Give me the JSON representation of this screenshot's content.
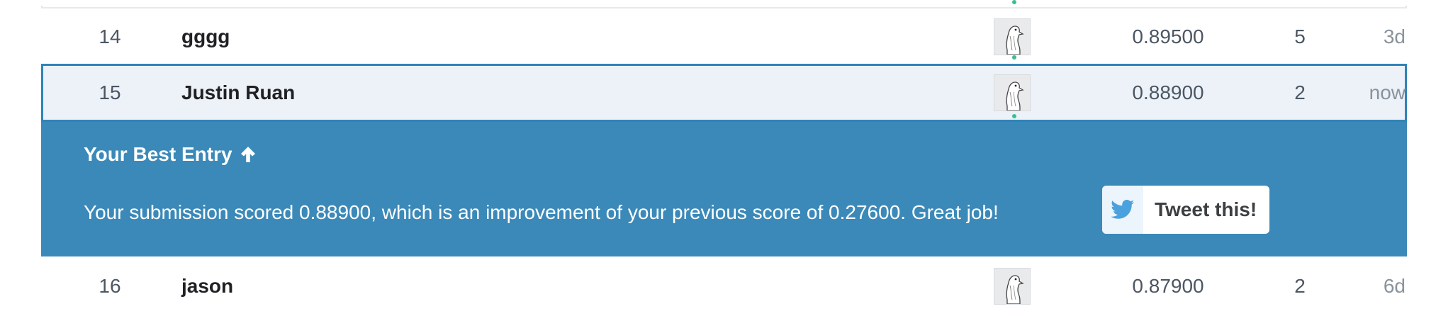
{
  "leaderboard": {
    "rows": [
      {
        "rank": "14",
        "team": "gggg",
        "score": "0.89500",
        "entries": "5",
        "last": "3d"
      },
      {
        "rank": "15",
        "team": "Justin Ruan",
        "score": "0.88900",
        "entries": "2",
        "last": "now"
      },
      {
        "rank": "16",
        "team": "jason",
        "score": "0.87900",
        "entries": "2",
        "last": "6d"
      }
    ]
  },
  "best_entry": {
    "title": "Your Best Entry",
    "message": "Your submission scored 0.88900, which is an improvement of your previous score of 0.27600. Great job!",
    "tweet_label": "Tweet this!"
  },
  "colors": {
    "panel": "#3b89b8",
    "highlight_border": "#2f84b8",
    "twitter_blue": "#4aa1dd",
    "online_dot": "#39c08f"
  },
  "icons": {
    "arrow": "arrow-up-icon",
    "twitter": "twitter-icon",
    "avatar": "goose-avatar"
  }
}
